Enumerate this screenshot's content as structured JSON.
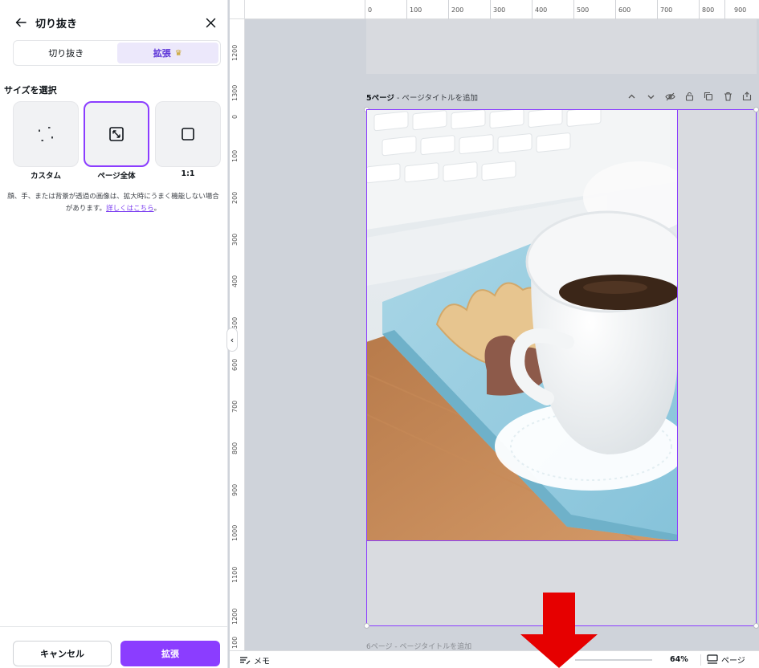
{
  "panel": {
    "title": "切り抜き",
    "tabs": [
      {
        "label": "切り抜き"
      },
      {
        "label": "拡張",
        "crown": "♛"
      }
    ],
    "section_title": "サイズを選択",
    "options": [
      {
        "label": "カスタム"
      },
      {
        "label": "ページ全体"
      },
      {
        "label": "1:1"
      }
    ],
    "hint_text": "顔、手、または背景が透過の画像は、拡大時にうまく機能しない場合があります。",
    "hint_link": "詳しくはこちら",
    "cancel_label": "キャンセル",
    "primary_label": "拡張"
  },
  "ruler": {
    "top": [
      "0",
      "100",
      "200",
      "300",
      "400",
      "500",
      "600",
      "700",
      "800",
      "900"
    ],
    "left": [
      "1200",
      "1300",
      "0",
      "100",
      "200",
      "300",
      "400",
      "500",
      "600",
      "700",
      "800",
      "900",
      "1000",
      "1100",
      "1200",
      "100"
    ]
  },
  "page": {
    "number_label": "5ページ",
    "separator": " - ",
    "title_placeholder": "ページタイトルを追加",
    "next_hint": "6ページ - ページタイトルを追加"
  },
  "bottom": {
    "memo_label": "メモ",
    "zoom": "64%",
    "pages_label": "ページ"
  },
  "colors": {
    "accent": "#8b3dff",
    "arrow": "#e60000"
  }
}
